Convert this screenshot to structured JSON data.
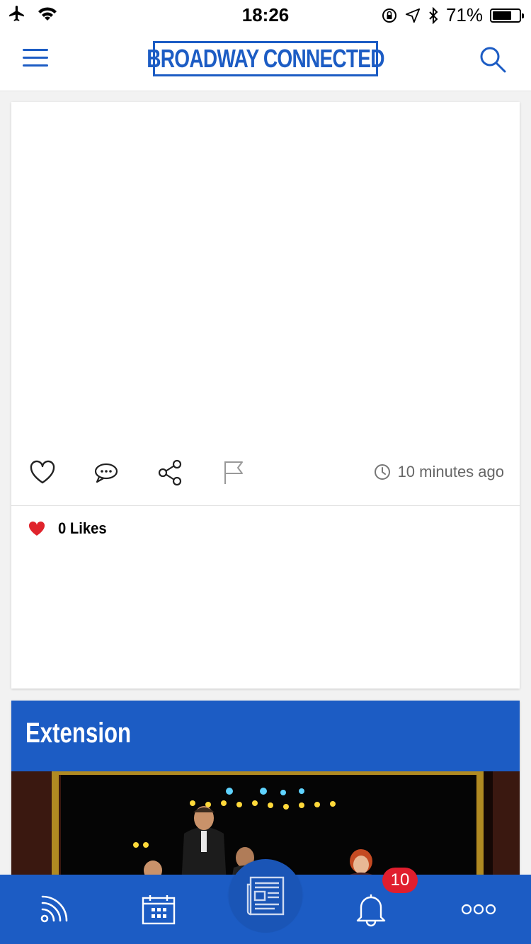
{
  "status_bar": {
    "time": "18:26",
    "battery": "71%",
    "battery_level": 0.71,
    "icons": [
      "airplane-icon",
      "wifi-icon",
      "orientation-lock-icon",
      "location-icon",
      "bluetooth-icon",
      "battery-icon"
    ]
  },
  "header": {
    "logo_text": "BROADWAY CONNECTED",
    "brand_color": "#1c5cc4",
    "menu_icon": "hamburger-menu-icon",
    "search_icon": "search-icon"
  },
  "post": {
    "actions": [
      "heart-icon",
      "comment-icon",
      "share-icon",
      "flag-icon"
    ],
    "time_ago": "10 minutes ago",
    "likes": "0 Likes"
  },
  "next_post": {
    "title": "Extension"
  },
  "tab_bar": {
    "tabs": [
      "feed-icon",
      "calendar-icon",
      "news-icon",
      "bell-icon",
      "more-icon"
    ],
    "notification_count": "10",
    "badge_color": "#e01e2e"
  }
}
